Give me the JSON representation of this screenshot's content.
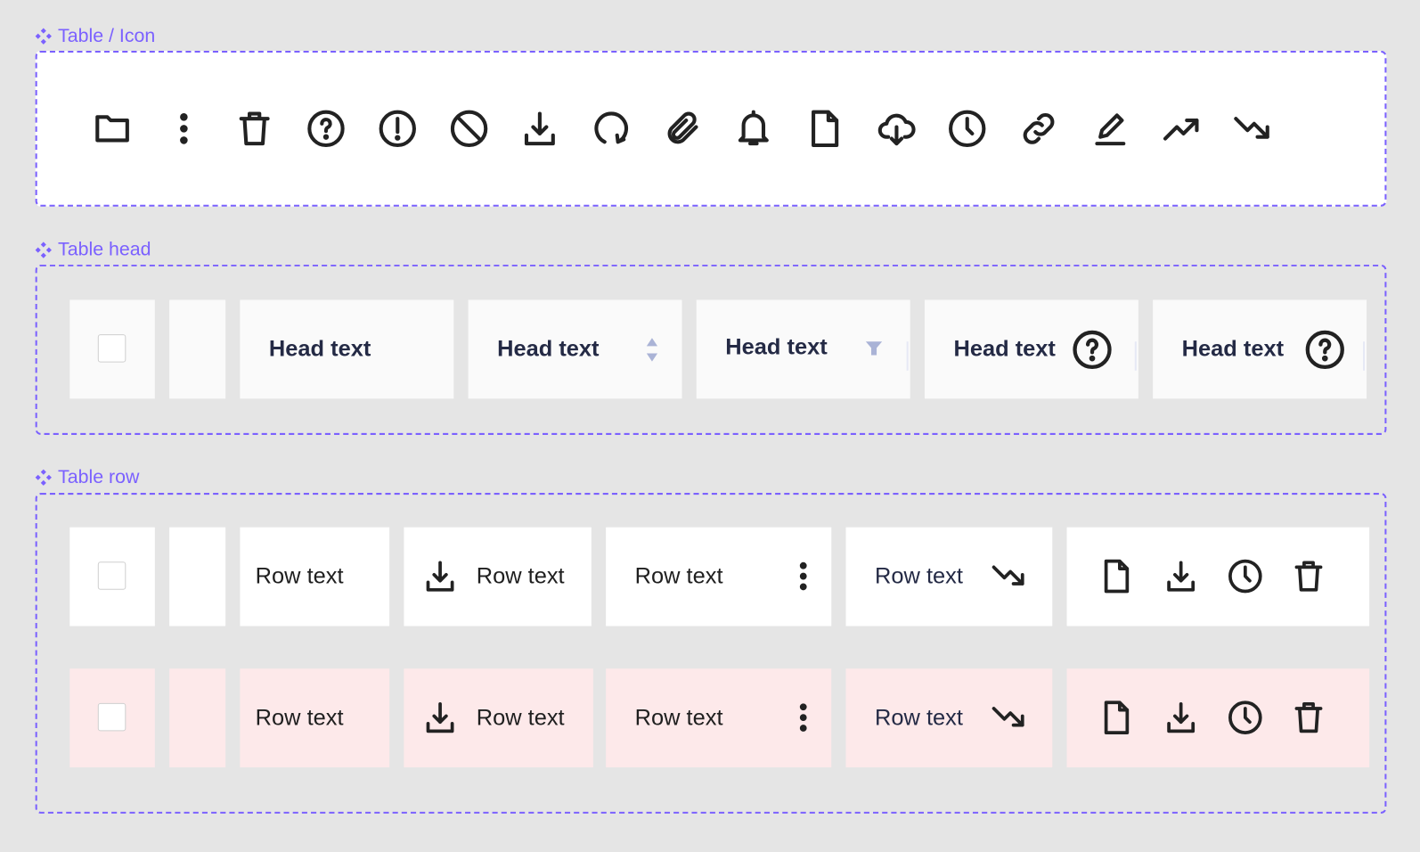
{
  "sections": {
    "icon": "Table / Icon",
    "head": "Table head",
    "row": "Table row"
  },
  "icons": [
    "folder-icon",
    "more-vertical-icon",
    "trash-icon",
    "help-circle-icon",
    "alert-circle-icon",
    "block-icon",
    "download-icon",
    "refresh-icon",
    "attachment-icon",
    "bell-icon",
    "file-icon",
    "cloud-download-icon",
    "clock-icon",
    "link-icon",
    "edit-icon",
    "trending-up-icon",
    "trending-down-icon"
  ],
  "head": {
    "cells": [
      "Head text",
      "Head text",
      "Head text",
      "Head text",
      "Head text"
    ]
  },
  "rows": [
    {
      "cells": [
        "Row text",
        "Row text",
        "Row text",
        "Row text"
      ]
    },
    {
      "cells": [
        "Row text",
        "Row text",
        "Row text",
        "Row text"
      ]
    }
  ],
  "colors": {
    "accent": "#7b61ff",
    "head_bg": "#fafafa",
    "head_text": "#242a45",
    "row_alt_bg": "#fde9ea",
    "sort_icon": "#aab3d6"
  }
}
